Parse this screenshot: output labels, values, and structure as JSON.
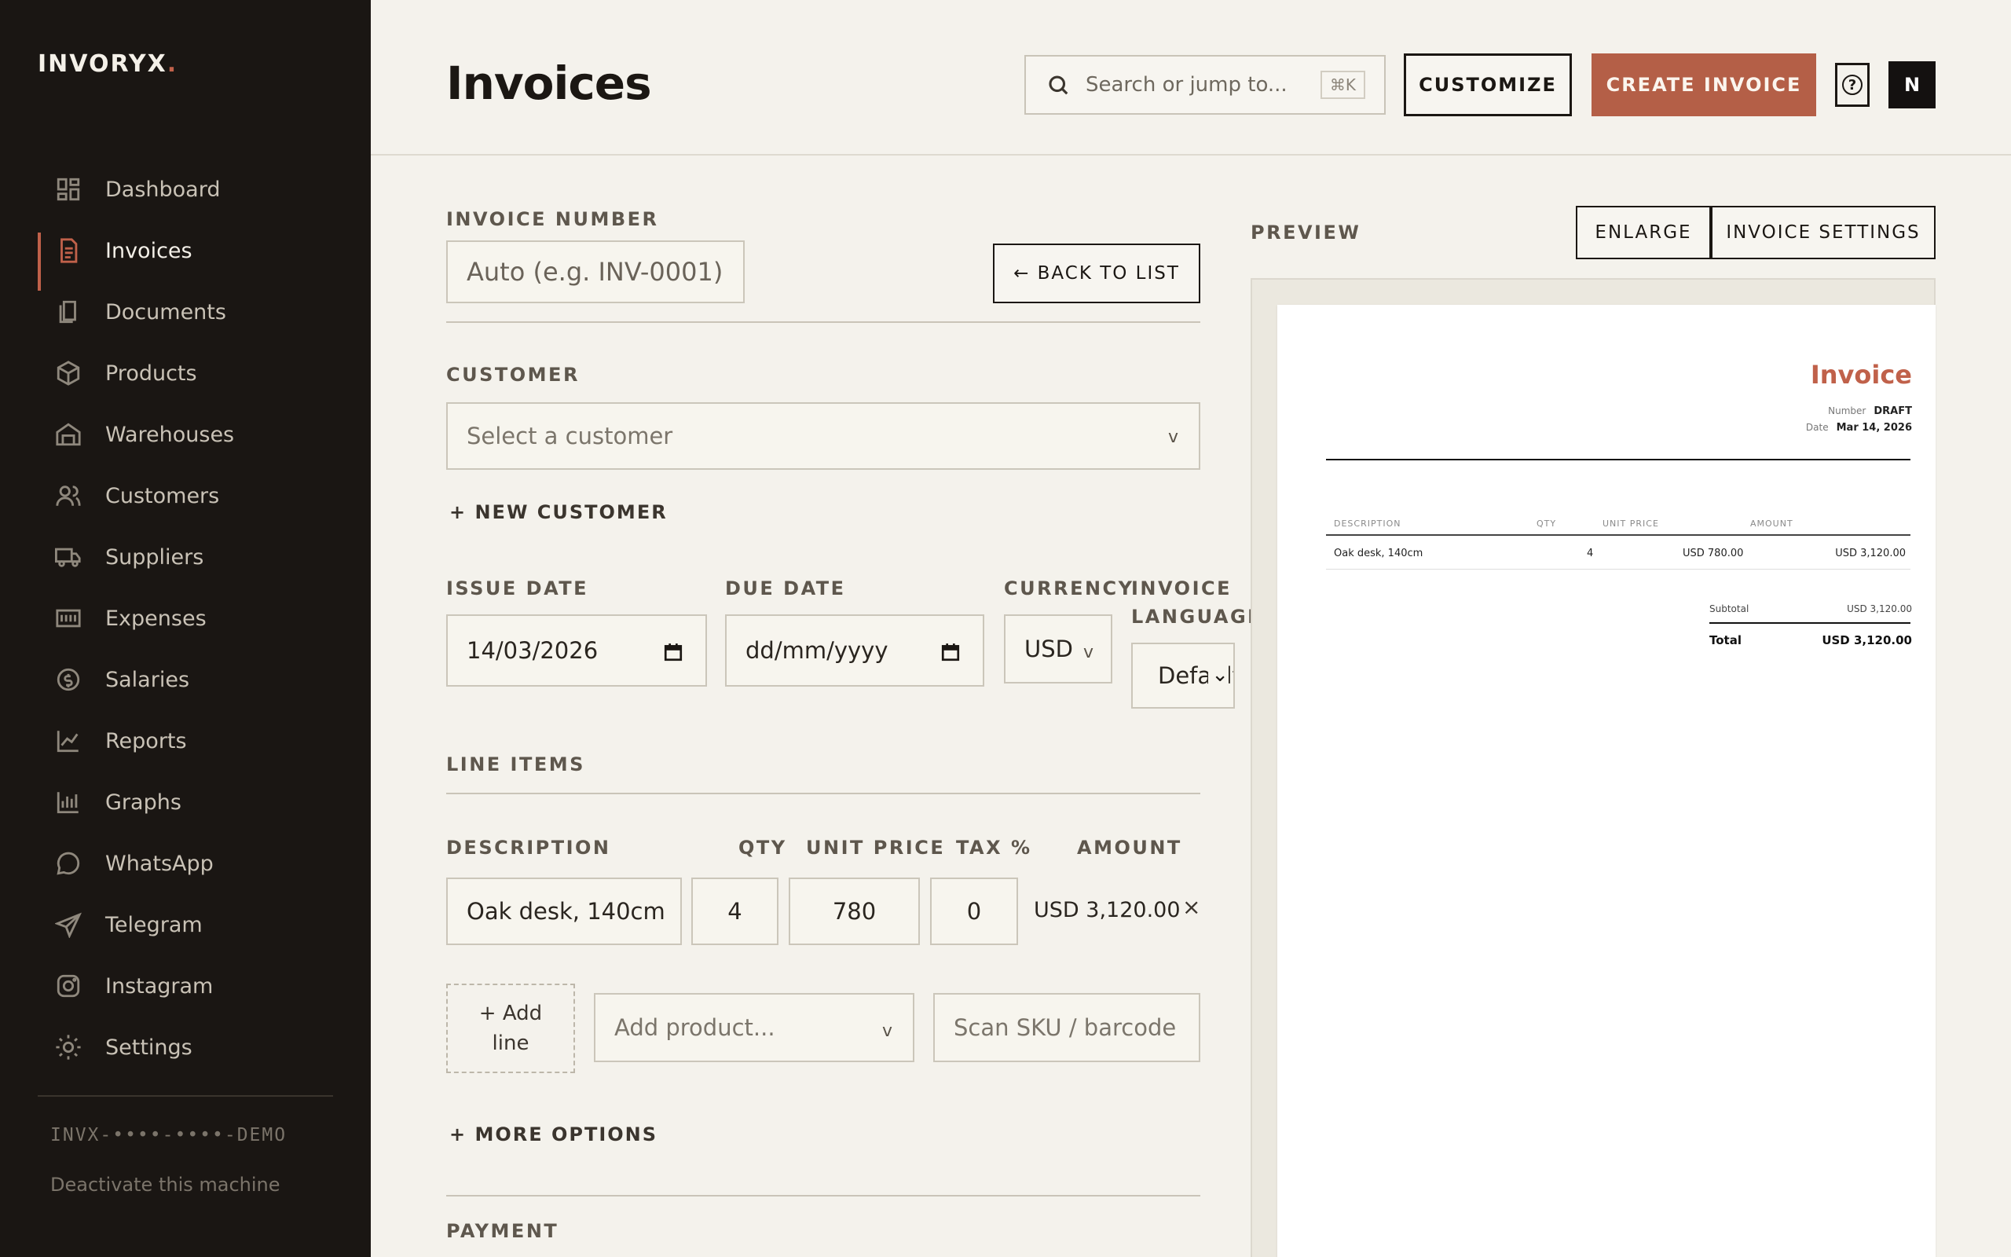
{
  "brand": {
    "name": "INVORYX",
    "dot": "."
  },
  "nav": {
    "items": [
      {
        "label": "Dashboard",
        "icon": "dashboard-icon"
      },
      {
        "label": "Invoices",
        "icon": "invoice-icon"
      },
      {
        "label": "Documents",
        "icon": "documents-icon"
      },
      {
        "label": "Products",
        "icon": "box-icon"
      },
      {
        "label": "Warehouses",
        "icon": "warehouse-icon"
      },
      {
        "label": "Customers",
        "icon": "users-icon"
      },
      {
        "label": "Suppliers",
        "icon": "truck-icon"
      },
      {
        "label": "Expenses",
        "icon": "bill-icon"
      },
      {
        "label": "Salaries",
        "icon": "coin-icon"
      },
      {
        "label": "Reports",
        "icon": "line-chart-icon"
      },
      {
        "label": "Graphs",
        "icon": "bar-chart-icon"
      },
      {
        "label": "WhatsApp",
        "icon": "chat-bubble-icon"
      },
      {
        "label": "Telegram",
        "icon": "paper-plane-icon"
      },
      {
        "label": "Instagram",
        "icon": "camera-icon"
      },
      {
        "label": "Settings",
        "icon": "gear-icon"
      }
    ],
    "active": "Invoices"
  },
  "license": {
    "key": "INVX-••••-••••-DEMO",
    "deactivate": "Deactivate this machine"
  },
  "header": {
    "title": "Invoices",
    "search_placeholder": "Search or jump to...",
    "shortcut": "⌘K",
    "customize": "CUSTOMIZE",
    "create": "CREATE INVOICE",
    "help": "?",
    "avatar": "N"
  },
  "form": {
    "invoice_number": {
      "label": "INVOICE NUMBER",
      "placeholder": "Auto (e.g. INV-0001)"
    },
    "back": "← BACK TO LIST",
    "customer": {
      "label": "CUSTOMER",
      "placeholder": "Select a customer",
      "new": "+ NEW CUSTOMER"
    },
    "issue_date": {
      "label": "ISSUE DATE",
      "value": "14/03/2026"
    },
    "due_date": {
      "label": "DUE DATE",
      "value": "dd/mm/yyyy"
    },
    "currency": {
      "label": "CURRENCY",
      "value": "USD"
    },
    "invoice_language": {
      "label_1": "INVOICE",
      "label_2": "LANGUAGE",
      "value": "Default"
    },
    "line_items": {
      "label": "LINE ITEMS",
      "headers": {
        "description": "DESCRIPTION",
        "qty": "QTY",
        "unit_price": "UNIT PRICE",
        "tax": "TAX %",
        "amount": "AMOUNT"
      },
      "rows": [
        {
          "description": "Oak desk, 140cm",
          "qty": "4",
          "unit_price": "780",
          "tax": "0",
          "amount": "USD 3,120.00"
        }
      ],
      "add_line_1": "+ Add",
      "add_line_2": "line",
      "add_product": "Add product...",
      "scan": "Scan SKU / barcode"
    },
    "more_options": "+ MORE OPTIONS",
    "payment": "PAYMENT"
  },
  "preview": {
    "label": "PREVIEW",
    "enlarge": "ENLARGE",
    "settings": "INVOICE SETTINGS",
    "doc": {
      "title": "Invoice",
      "number_label": "Number",
      "number_value": "DRAFT",
      "date_label": "Date",
      "date_value": "Mar 14, 2026",
      "headers": {
        "description": "DESCRIPTION",
        "qty": "QTY",
        "unit_price": "UNIT PRICE",
        "amount": "AMOUNT"
      },
      "row": {
        "description": "Oak desk, 140cm",
        "qty": "4",
        "unit_price": "USD 780.00",
        "amount": "USD 3,120.00"
      },
      "subtotal_label": "Subtotal",
      "subtotal_value": "USD 3,120.00",
      "total_label": "Total",
      "total_value": "USD 3,120.00"
    }
  },
  "colors": {
    "accent": "#b45f47",
    "sidebar": "#1a1613",
    "background": "#f4f2ec"
  }
}
